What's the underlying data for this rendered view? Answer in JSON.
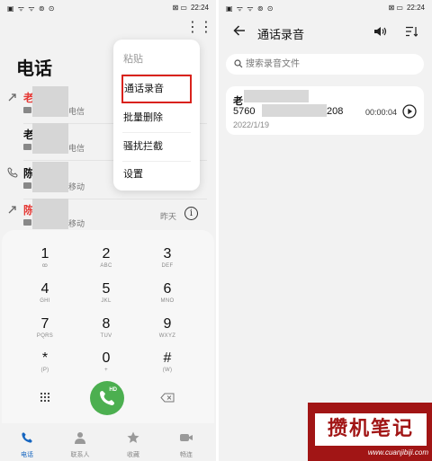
{
  "status_bar": {
    "left_icons": "▣ ᯤ ᯤ ⊚ ⊙",
    "right_icons": "⊠ ▭",
    "time": "22:24"
  },
  "dialer": {
    "title": "电话",
    "recent_calls": [
      {
        "name": "老",
        "location": "电信",
        "missed": true,
        "icon": "outgoing-call-icon"
      },
      {
        "name": "老",
        "location": "电信",
        "missed": false,
        "icon": ""
      },
      {
        "name": "陈",
        "location": "移动",
        "missed": false,
        "icon": "incoming-call-icon"
      },
      {
        "name": "陈",
        "location": "移动",
        "missed": true,
        "icon": "outgoing-call-icon"
      }
    ],
    "recent_time": "昨天",
    "overflow_menu": [
      {
        "label": "粘贴",
        "disabled": true
      },
      {
        "label": "通话录音",
        "highlighted": true
      },
      {
        "label": "批量删除"
      },
      {
        "label": "骚扰拦截"
      },
      {
        "label": "设置"
      }
    ],
    "keys": [
      {
        "digit": "1",
        "sub": "ꝏ"
      },
      {
        "digit": "2",
        "sub": "ABC"
      },
      {
        "digit": "3",
        "sub": "DEF"
      },
      {
        "digit": "4",
        "sub": "GHI"
      },
      {
        "digit": "5",
        "sub": "JKL"
      },
      {
        "digit": "6",
        "sub": "MNO"
      },
      {
        "digit": "7",
        "sub": "PQRS"
      },
      {
        "digit": "8",
        "sub": "TUV"
      },
      {
        "digit": "9",
        "sub": "WXYZ"
      },
      {
        "digit": "*",
        "sub": "(P)"
      },
      {
        "digit": "0",
        "sub": "+"
      },
      {
        "digit": "#",
        "sub": "(W)"
      }
    ],
    "call_button_badge": "HD",
    "bottom_nav": [
      {
        "label": "电话",
        "active": true
      },
      {
        "label": "联系人"
      },
      {
        "label": "收藏"
      },
      {
        "label": "畅连"
      }
    ]
  },
  "recordings": {
    "title": "通话录音",
    "search_placeholder": "搜索录音文件",
    "items": [
      {
        "name": "老",
        "number_prefix": "5760",
        "number_suffix": "208",
        "date": "2022/1/19",
        "duration": "00:00:04"
      }
    ]
  },
  "watermark": {
    "text": "攒机笔记",
    "url": "www.cuanjibiji.com"
  },
  "colors": {
    "accent_blue": "#1565c0",
    "missed_red": "#e53935",
    "call_green": "#4caf50",
    "highlight_red": "#d9221c",
    "watermark_red": "#a11515"
  }
}
